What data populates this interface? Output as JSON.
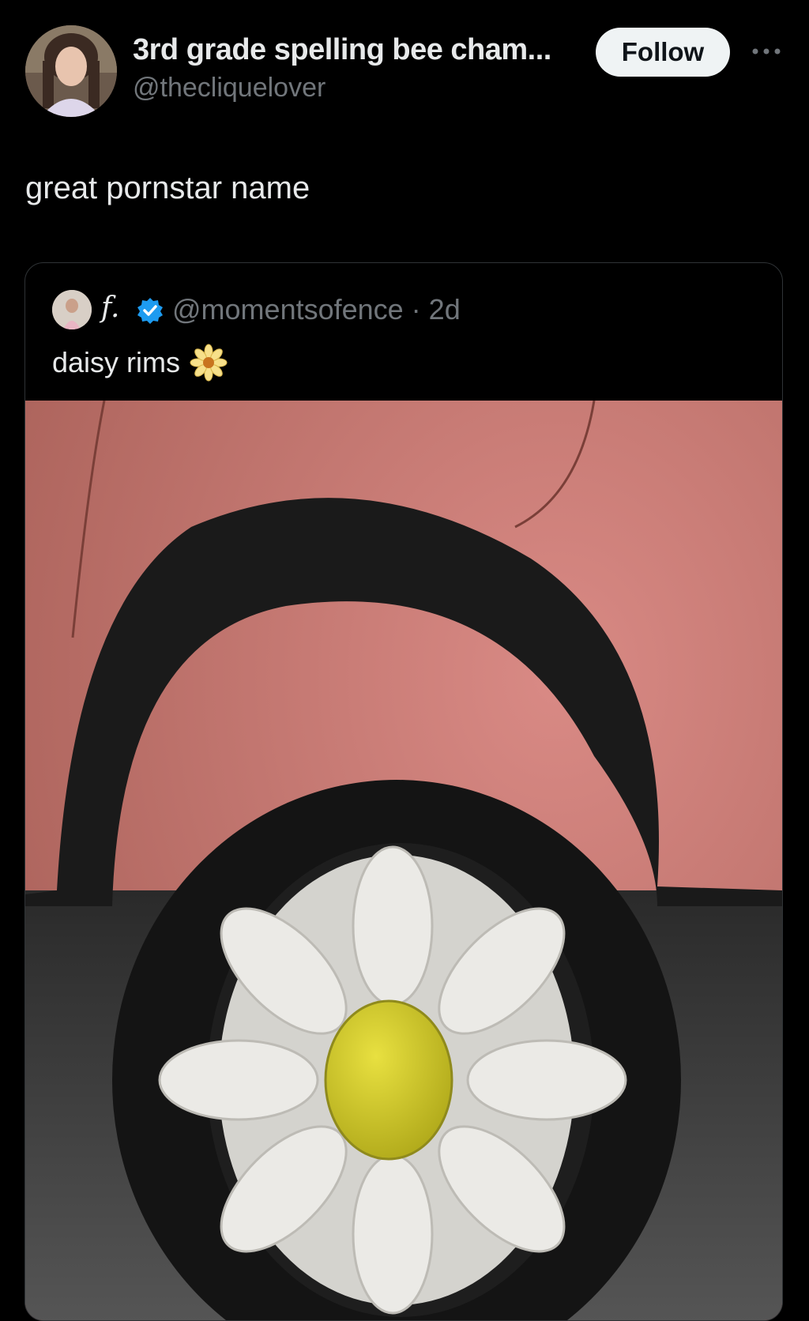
{
  "author": {
    "display_name": "3rd grade spelling bee cham...",
    "handle": "@thecliquelover",
    "follow_label": "Follow"
  },
  "tweet": {
    "text": "great pornstar name"
  },
  "quoted": {
    "display_name": "f.",
    "handle_time": "@momentsofence · 2d",
    "text": "daisy rims",
    "emoji": "daisy-emoji",
    "verified": true
  },
  "colors": {
    "background": "#000000",
    "text": "#e7e9ea",
    "secondary": "#71767b",
    "verified": "#1d9bf0",
    "follow_bg": "#eff3f4"
  },
  "icons": [
    "more-icon",
    "verified-badge-icon",
    "daisy-emoji"
  ]
}
